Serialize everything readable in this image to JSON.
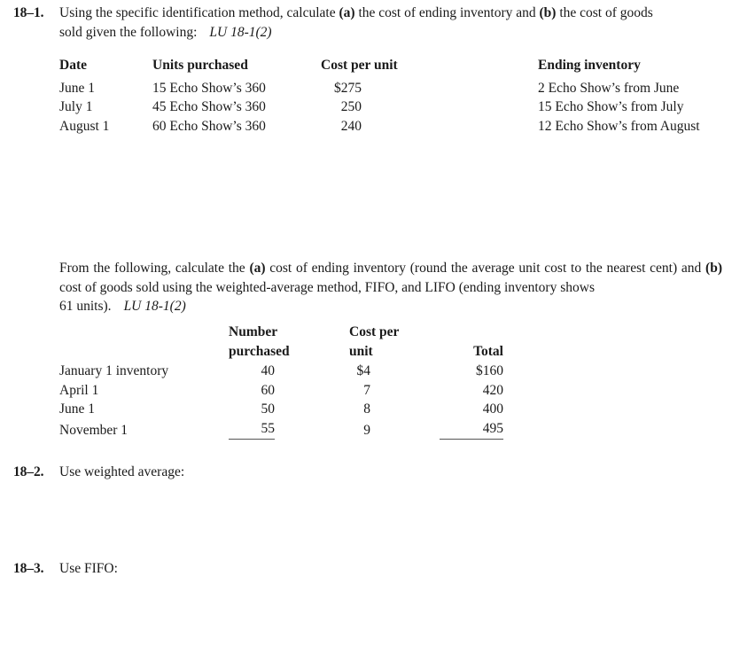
{
  "document": {
    "type": "accounting-worksheet",
    "background_color": "#ffffff",
    "text_color": "#1a1a1a"
  },
  "problems": [
    {
      "number": "18–1.",
      "intro_line_1_a": "Using the specific identification method, calculate ",
      "intro_bold_a": "(a)",
      "intro_line_1_b": " the cost of ending inventory and ",
      "intro_bold_b": "(b)",
      "intro_line_1_c": " the cost of goods",
      "intro_line_2": "sold given the following:",
      "lu_reference": "LU 18-1(2)"
    },
    {
      "number": "18–2.",
      "text": "Use weighted average:"
    },
    {
      "number": "18–3.",
      "text": "Use FIFO:"
    }
  ],
  "table_one": {
    "headers": {
      "date": "Date",
      "units_purchased": "Units purchased",
      "cost_per_unit": "Cost per unit",
      "ending_inventory": "Ending inventory"
    },
    "rows": [
      {
        "date": "June 1",
        "units_purchased": "15 Echo Show’s 360",
        "cost_per_unit": "$275",
        "ending_inventory": "2 Echo Show’s from June"
      },
      {
        "date": "July 1",
        "units_purchased": "45 Echo Show’s 360",
        "cost_per_unit": "250",
        "ending_inventory": "15 Echo Show’s from July"
      },
      {
        "date": "August 1",
        "units_purchased": "60 Echo Show’s 360",
        "cost_per_unit": "240",
        "ending_inventory": "12 Echo Show’s from August"
      }
    ]
  },
  "paragraph_two": {
    "line_1_a": "From the following, calculate the ",
    "bold_a": "(a)",
    "line_1_b": " cost of ending inventory (round the average unit cost to the nearest cent)",
    "line_2_a": "and ",
    "bold_b": "(b)",
    "line_2_b": " cost of goods sold using the weighted-average method, FIFO, and LIFO (ending inventory shows",
    "line_3": "61 units).",
    "lu_reference": "LU 18-1(2)"
  },
  "table_two": {
    "headers": {
      "blank": "",
      "number_purchased_line1": "Number",
      "number_purchased_line2": "purchased",
      "cost_per_unit_line1": "Cost per",
      "cost_per_unit_line2": "unit",
      "total": "Total"
    },
    "rows": [
      {
        "label": "January 1 inventory",
        "number_purchased": "40",
        "cost_per_unit": "$4",
        "total": "$160",
        "ruled": false
      },
      {
        "label": "April 1",
        "number_purchased": "60",
        "cost_per_unit": "7",
        "total": "420",
        "ruled": false
      },
      {
        "label": "June 1",
        "number_purchased": "50",
        "cost_per_unit": "8",
        "total": "400",
        "ruled": false
      },
      {
        "label": "November 1",
        "number_purchased": "55",
        "cost_per_unit": "9",
        "total": "495",
        "ruled": true
      }
    ]
  }
}
